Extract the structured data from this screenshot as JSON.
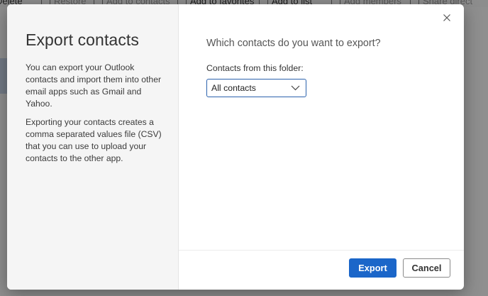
{
  "background_toolbar": {
    "items": [
      "Delete",
      "Restore",
      "Add to contacts",
      "Add to favorites",
      "Add to list",
      "Add members",
      "Share",
      "Share direct"
    ]
  },
  "dialog": {
    "title": "Export contacts",
    "description_1": "You can export your Outlook contacts and import them into other email apps such as Gmail and Yahoo.",
    "description_2": "Exporting your contacts creates a comma separated values file (CSV) that you can use to upload your contacts to the other app.",
    "question": "Which contacts do you want to export?",
    "folder_label": "Contacts from this folder:",
    "folder_select": {
      "value": "All contacts",
      "icon": "chevron-down-icon"
    },
    "close_icon": "close-icon",
    "export_label": "Export",
    "cancel_label": "Cancel"
  },
  "colors": {
    "primary": "#1b66c9",
    "select_border": "#2b62ad",
    "left_panel_bg": "#f5f5f5"
  }
}
